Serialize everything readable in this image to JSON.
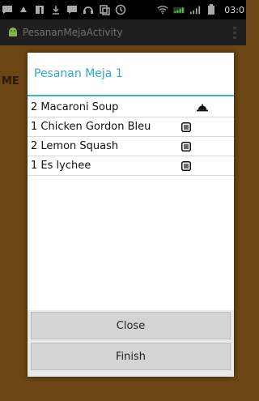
{
  "status_bar": {
    "time": "03:0"
  },
  "app": {
    "title": "PesananMejaActivity"
  },
  "background": {
    "partial_text": "ME"
  },
  "dialog": {
    "title": "Pesanan Meja 1",
    "orders": [
      {
        "text": "2 Macaroni Soup",
        "status_icon": "serving-cloche-icon"
      },
      {
        "text": "1 Chicken Gordon Bleu",
        "status_icon": "list-icon"
      },
      {
        "text": "2 Lemon Squash",
        "status_icon": "list-icon"
      },
      {
        "text": "1 Es lychee",
        "status_icon": "list-icon"
      }
    ],
    "close_label": "Close",
    "finish_label": "Finish"
  }
}
